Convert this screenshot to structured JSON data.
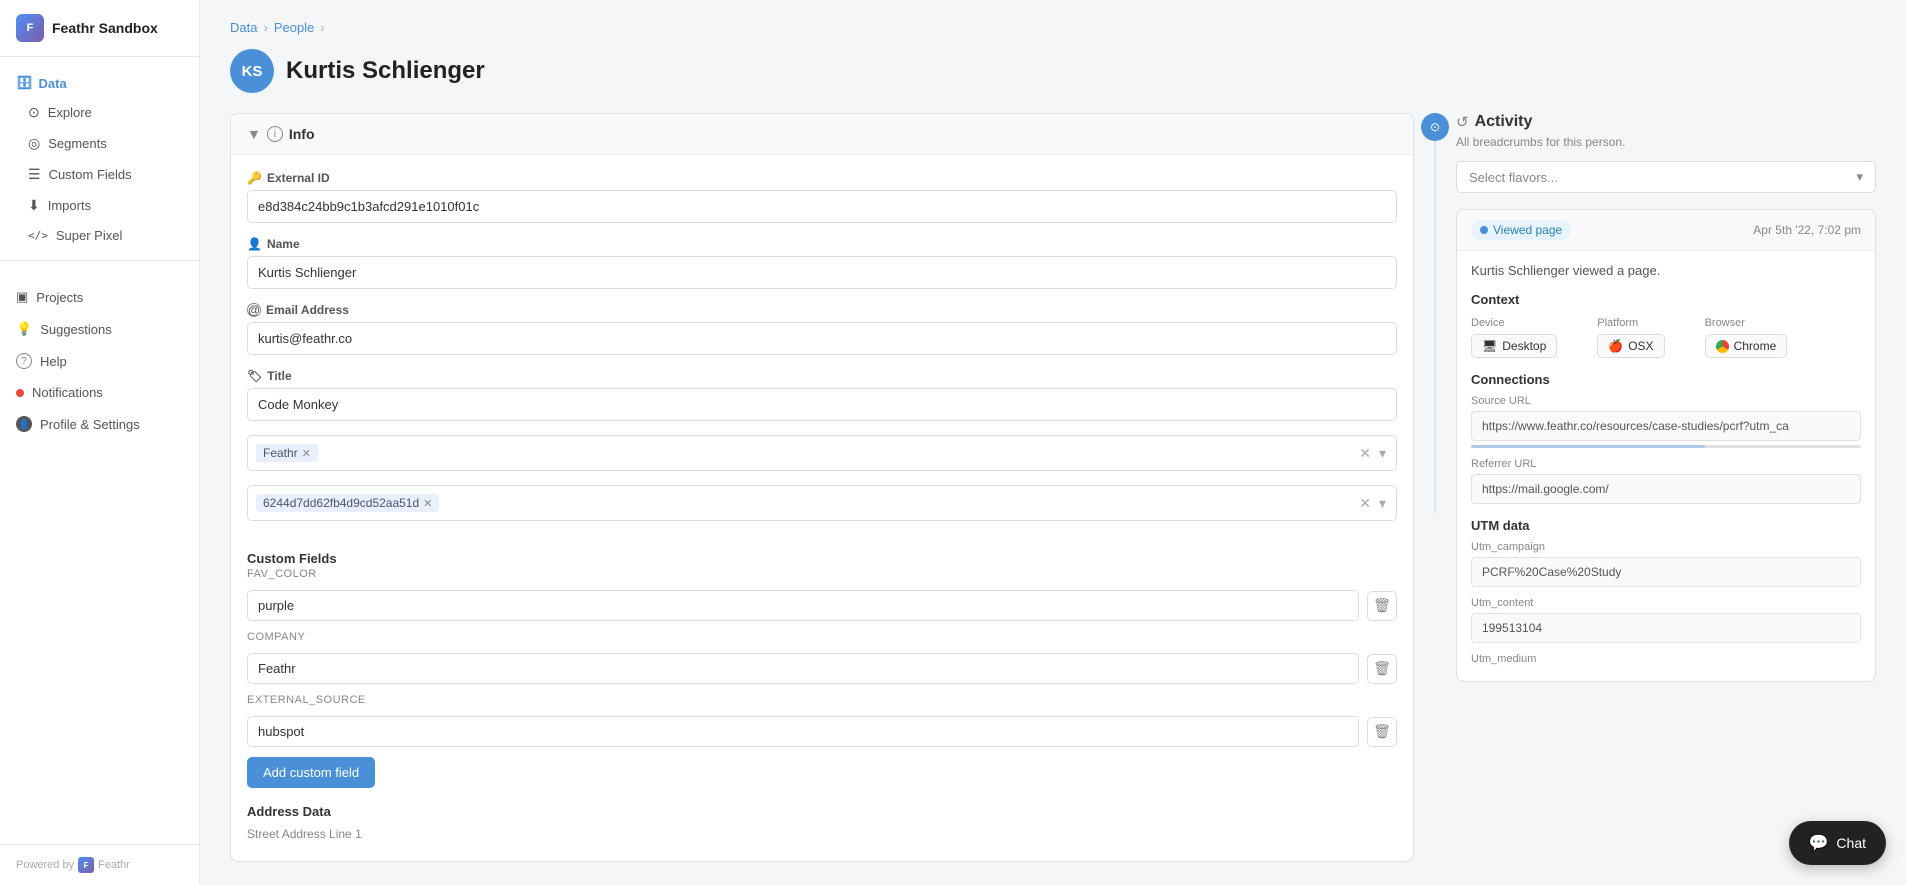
{
  "brand": {
    "logo_initials": "F",
    "name": "Feathr Sandbox"
  },
  "sidebar": {
    "section_label": "Data",
    "nav_items": [
      {
        "id": "explore",
        "label": "Explore",
        "icon": "⊙"
      },
      {
        "id": "segments",
        "label": "Segments",
        "icon": "◎"
      },
      {
        "id": "custom-fields",
        "label": "Custom Fields",
        "icon": "☰"
      },
      {
        "id": "imports",
        "label": "Imports",
        "icon": "⬇"
      },
      {
        "id": "super-pixel",
        "label": "Super Pixel",
        "icon": "</>"
      }
    ],
    "bottom_items": [
      {
        "id": "projects",
        "label": "Projects",
        "icon": "▣"
      },
      {
        "id": "suggestions",
        "label": "Suggestions",
        "icon": "💡"
      },
      {
        "id": "help",
        "label": "Help",
        "icon": "?"
      },
      {
        "id": "notifications",
        "label": "Notifications",
        "icon": "🔴",
        "has_dot": true
      },
      {
        "id": "profile",
        "label": "Profile & Settings",
        "icon": "👤"
      }
    ],
    "footer_text": "Powered by",
    "footer_brand": "Feathr"
  },
  "breadcrumb": {
    "items": [
      "Data",
      "People"
    ]
  },
  "person": {
    "initials": "KS",
    "name": "Kurtis Schlienger"
  },
  "info_panel": {
    "section_title": "Info",
    "external_id_label": "External ID",
    "external_id_icon": "🔑",
    "external_id_value": "e8d384c24bb9c1b3afcd291e1010f01c",
    "name_label": "Name",
    "name_icon": "👤",
    "name_value": "Kurtis Schlienger",
    "email_label": "Email Address",
    "email_icon": "@",
    "email_value": "kurtis@feathr.co",
    "title_label": "Title",
    "title_icon": "🏷",
    "title_value": "Code Monkey",
    "tag_row1": {
      "tags": [
        {
          "label": "Feathr"
        }
      ],
      "placeholder": ""
    },
    "tag_row2": {
      "tags": [
        {
          "label": "6244d7dd62fb4d9cd52aa51d"
        }
      ],
      "placeholder": ""
    },
    "custom_fields": {
      "section_title": "Custom Fields",
      "section_subtitle": "FAV_COLOR",
      "fields": [
        {
          "name": "FAV_COLOR",
          "subtitle": "FAV_COLOR",
          "value": "purple"
        },
        {
          "name": "company",
          "subtitle": "company",
          "value": "Feathr"
        },
        {
          "name": "external_source",
          "subtitle": "external_source",
          "value": "hubspot"
        }
      ],
      "add_button_label": "Add custom field"
    },
    "address": {
      "section_title": "Address Data",
      "street_label": "Street Address Line 1"
    }
  },
  "activity_panel": {
    "title": "Activity",
    "subtitle": "All breadcrumbs for this person.",
    "flavor_select_placeholder": "Select flavors...",
    "event": {
      "badge_label": "Viewed page",
      "date": "Apr 5th '22, 7:02 pm",
      "description": "Kurtis Schlienger viewed a page.",
      "context": {
        "title": "Context",
        "device_label": "Device",
        "device_value": "Desktop",
        "platform_label": "Platform",
        "platform_value": "OSX",
        "browser_label": "Browser",
        "browser_value": "Chrome"
      },
      "connections": {
        "title": "Connections",
        "source_url_label": "Source URL",
        "source_url_value": "https://www.feathr.co/resources/case-studies/pcrf?utm_ca",
        "referrer_url_label": "Referrer URL",
        "referrer_url_value": "https://mail.google.com/"
      },
      "utm": {
        "title": "UTM data",
        "campaign_label": "Utm_campaign",
        "campaign_value": "PCRF%20Case%20Study",
        "content_label": "Utm_content",
        "content_value": "199513104",
        "medium_label": "Utm_medium"
      }
    }
  },
  "chat_fab": {
    "label": "Chat",
    "icon": "💬"
  }
}
